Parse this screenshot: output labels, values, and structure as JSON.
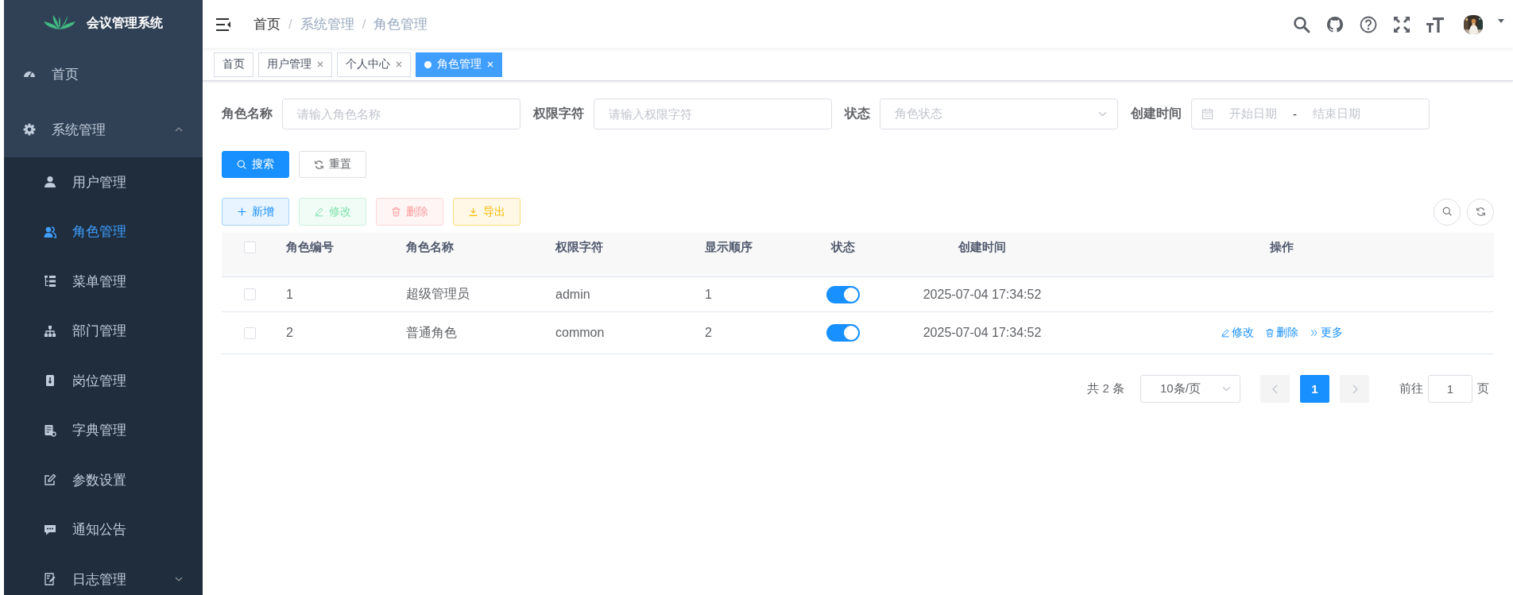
{
  "sidebar": {
    "logo_text": "会议管理系统",
    "items": [
      {
        "label": "首页",
        "kind": "link",
        "selected": false
      },
      {
        "label": "系统管理",
        "kind": "submenu",
        "expanded": true,
        "children": [
          {
            "label": "用户管理",
            "kind": "link",
            "selected": false
          },
          {
            "label": "角色管理",
            "kind": "link",
            "selected": true
          },
          {
            "label": "菜单管理",
            "kind": "link",
            "selected": false
          },
          {
            "label": "部门管理",
            "kind": "link",
            "selected": false
          },
          {
            "label": "岗位管理",
            "kind": "link",
            "selected": false
          },
          {
            "label": "字典管理",
            "kind": "link",
            "selected": false
          },
          {
            "label": "参数设置",
            "kind": "link",
            "selected": false
          },
          {
            "label": "通知公告",
            "kind": "link",
            "selected": false
          },
          {
            "label": "日志管理",
            "kind": "submenu",
            "expanded": false
          }
        ]
      }
    ]
  },
  "navbar": {
    "breadcrumb": [
      "首页",
      "系统管理",
      "角色管理"
    ],
    "separator": "/"
  },
  "tags": [
    {
      "label": "首页",
      "closable": false,
      "selected": false
    },
    {
      "label": "用户管理",
      "closable": true,
      "selected": false
    },
    {
      "label": "个人中心",
      "closable": true,
      "selected": false
    },
    {
      "label": "角色管理",
      "closable": true,
      "selected": true
    }
  ],
  "filters": [
    {
      "label": "角色名称",
      "kind": "text",
      "placeholder": "请输入角色名称"
    },
    {
      "label": "权限字符",
      "kind": "text",
      "placeholder": "请输入权限字符"
    },
    {
      "label": "状态",
      "kind": "select",
      "placeholder": "角色状态"
    },
    {
      "label": "创建时间",
      "kind": "daterange",
      "start_placeholder": "开始日期",
      "separator": "-",
      "end_placeholder": "结束日期"
    }
  ],
  "search_buttons": [
    {
      "label": "搜索",
      "kind": "primary"
    },
    {
      "label": "重置",
      "kind": "default"
    }
  ],
  "toolbar": [
    {
      "label": "新增",
      "kind": "primary",
      "disabled": false
    },
    {
      "label": "修改",
      "kind": "success",
      "disabled": true
    },
    {
      "label": "删除",
      "kind": "danger",
      "disabled": true
    },
    {
      "label": "导出",
      "kind": "warning",
      "disabled": false
    }
  ],
  "table": {
    "all_checked": false,
    "columns": [
      "角色编号",
      "角色名称",
      "权限字符",
      "显示顺序",
      "状态",
      "创建时间",
      "操作"
    ],
    "rows": [
      {
        "checked": false,
        "id": "1",
        "name": "超级管理员",
        "key": "admin",
        "order": "1",
        "status_on": true,
        "created": "2025-07-04 17:34:52",
        "actions": []
      },
      {
        "checked": false,
        "id": "2",
        "name": "普通角色",
        "key": "common",
        "order": "2",
        "status_on": true,
        "created": "2025-07-04 17:34:52",
        "actions": [
          {
            "label": "修改",
            "kind": "edit"
          },
          {
            "label": "删除",
            "kind": "delete"
          },
          {
            "label": "更多",
            "kind": "more"
          }
        ]
      }
    ]
  },
  "pagination": {
    "total": "共 2 条",
    "page_size": "10条/页",
    "prev_disabled": true,
    "next_disabled": true,
    "pages": [
      {
        "label": "1",
        "selected": true
      }
    ],
    "jump_label": "前往",
    "jump_value": "1",
    "jump_suffix": "页"
  }
}
